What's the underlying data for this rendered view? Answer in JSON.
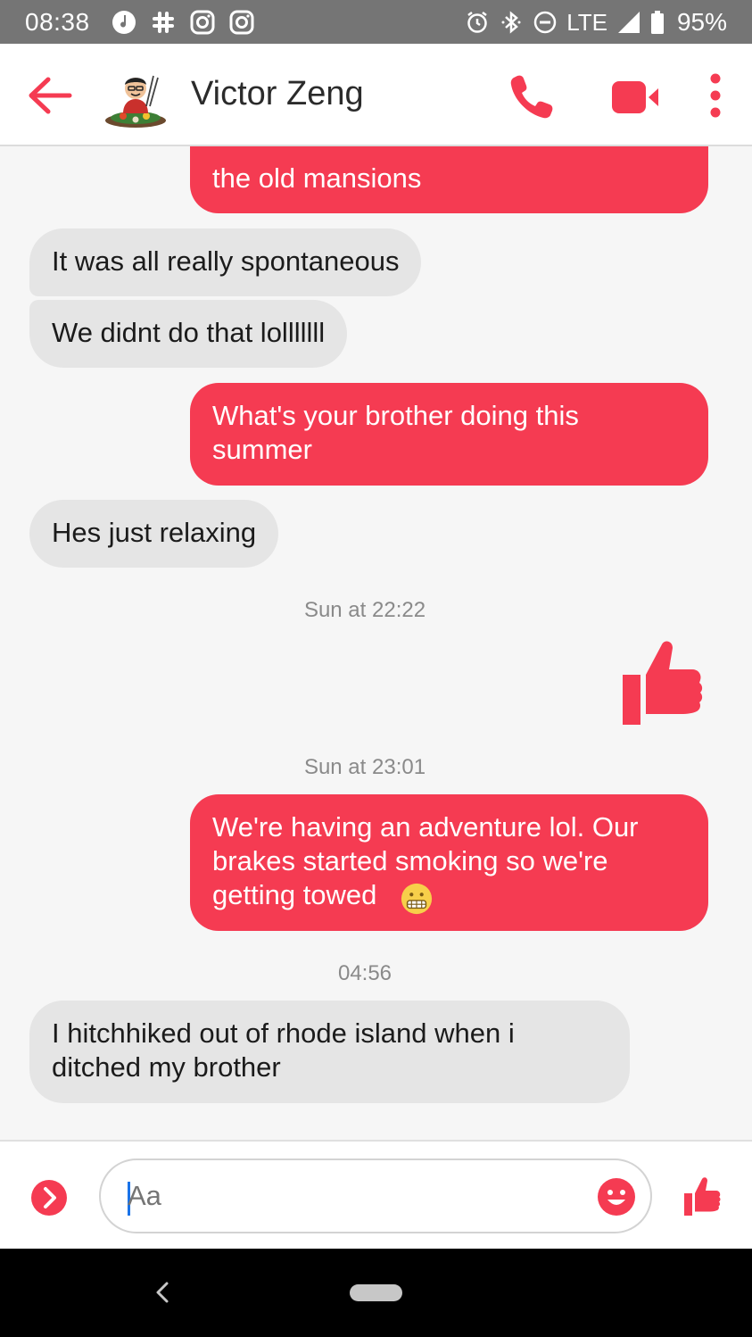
{
  "status_bar": {
    "time": "08:38",
    "network": "LTE",
    "battery": "95%"
  },
  "header": {
    "contact_name": "Victor Zeng"
  },
  "messages": [
    {
      "type": "outgoing",
      "text": "Newport we went to see some of the old mansions",
      "visible_text": "the old mansions"
    },
    {
      "type": "incoming",
      "text": "It was all really spontaneous"
    },
    {
      "type": "incoming",
      "text": "We didnt do that lolllllll"
    },
    {
      "type": "outgoing",
      "text": "What's your brother doing this summer"
    },
    {
      "type": "incoming",
      "text": "Hes just relaxing"
    },
    {
      "type": "timestamp",
      "text": "Sun at 22:22"
    },
    {
      "type": "outgoing-like"
    },
    {
      "type": "timestamp",
      "text": "Sun at 23:01"
    },
    {
      "type": "outgoing",
      "text": "We're having an adventure lol. Our brakes started smoking so we're getting towed"
    },
    {
      "type": "timestamp",
      "text": "04:56"
    },
    {
      "type": "incoming",
      "text": "I hitchhiked out of rhode island when i ditched my brother"
    }
  ],
  "composer": {
    "placeholder": "Aa"
  },
  "colors": {
    "accent": "#f53b52",
    "incoming_bubble": "#e5e5e5",
    "status_bar": "#757575"
  }
}
